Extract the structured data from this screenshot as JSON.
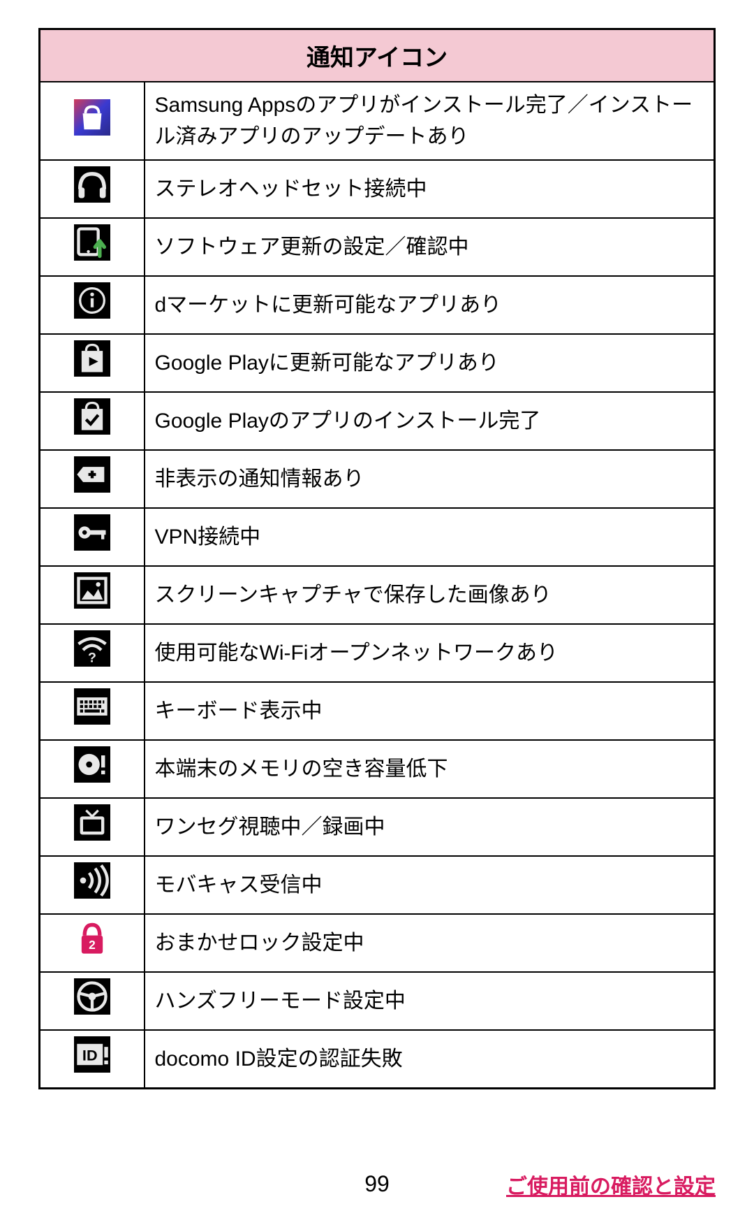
{
  "table": {
    "header": "通知アイコン",
    "rows": [
      {
        "icon": "samsung-bag-icon",
        "desc": "Samsung Appsのアプリがインストール完了／インストール済みアプリのアップデートあり"
      },
      {
        "icon": "headphones-icon",
        "desc": "ステレオヘッドセット接続中"
      },
      {
        "icon": "software-update-icon",
        "desc": "ソフトウェア更新の設定／確認中"
      },
      {
        "icon": "info-circle-icon",
        "desc": "dマーケットに更新可能なアプリあり"
      },
      {
        "icon": "play-bag-icon",
        "desc": "Google Playに更新可能なアプリあり"
      },
      {
        "icon": "check-bag-icon",
        "desc": "Google Playのアプリのインストール完了"
      },
      {
        "icon": "plus-tag-icon",
        "desc": "非表示の通知情報あり"
      },
      {
        "icon": "key-icon",
        "desc": "VPN接続中"
      },
      {
        "icon": "picture-frame-icon",
        "desc": "スクリーンキャプチャで保存した画像あり"
      },
      {
        "icon": "wifi-question-icon",
        "desc": "使用可能なWi-Fiオープンネットワークあり"
      },
      {
        "icon": "keyboard-icon",
        "desc": "キーボード表示中"
      },
      {
        "icon": "disc-alert-icon",
        "desc": "本端末のメモリの空き容量低下"
      },
      {
        "icon": "tv-icon",
        "desc": "ワンセグ視聴中／録画中"
      },
      {
        "icon": "broadcast-wave-icon",
        "desc": "モバキャス受信中"
      },
      {
        "icon": "lock-red-icon",
        "desc": "おまかせロック設定中"
      },
      {
        "icon": "steering-wheel-icon",
        "desc": "ハンズフリーモード設定中"
      },
      {
        "icon": "id-alert-icon",
        "desc": "docomo ID設定の認証失敗"
      }
    ]
  },
  "footer": {
    "page": "99",
    "link": "ご使用前の確認と設定"
  }
}
